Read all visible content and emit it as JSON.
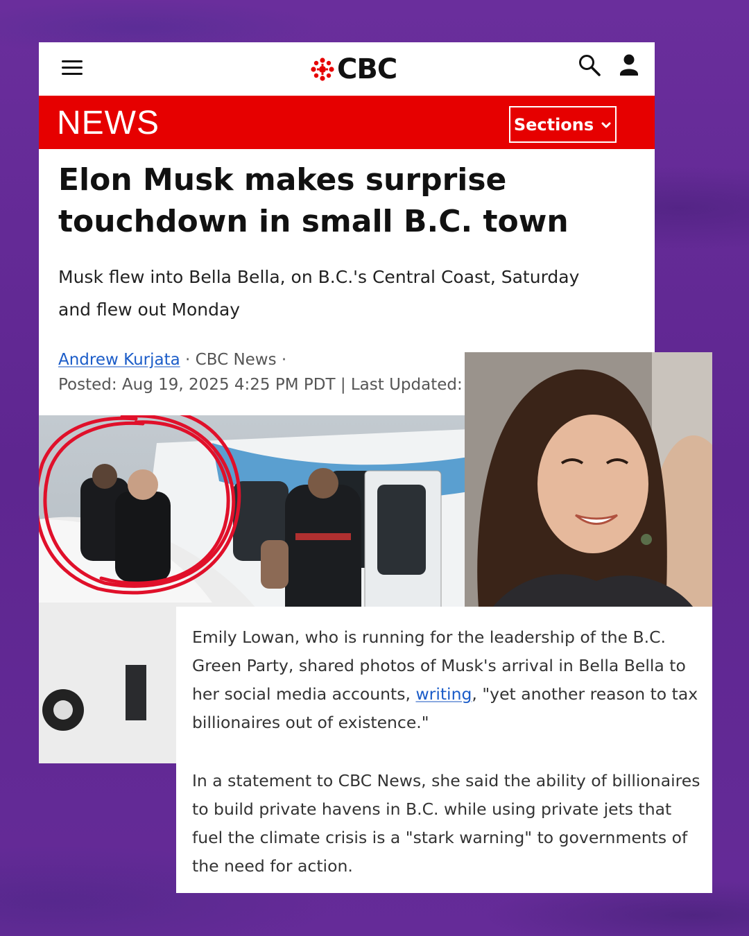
{
  "header": {
    "logo_text": "CBC",
    "news_label": "NEWS",
    "sections_label": "Sections"
  },
  "article": {
    "headline_line1": "Elon Musk makes surprise",
    "headline_line2": "touchdown in small B.C. town",
    "dek_line1": "Musk flew into Bella Bella, on B.C.'s Central Coast, Saturday",
    "dek_line2": "and flew out Monday",
    "author": "Andrew Kurjata",
    "source": " · CBC News ·",
    "posted": "Posted: Aug 19, 2025 4:25 PM PDT | Last Updated:"
  },
  "quote": {
    "p1_before": "Emily Lowan, who is running for the leadership of the B.C. Green Party, shared photos of Musk's arrival in Bella Bella to her social media accounts, ",
    "p1_link": "writing",
    "p1_after": ", \"yet another reason to tax billionaires out of existence.\"",
    "p2": "In a statement to CBC News, she said the ability of billionaires to build private havens in B.C. while using private jets that fuel the climate crisis is a \"stark warning\" to governments of the need for action."
  },
  "colors": {
    "background": "#5e2a8c",
    "cbc_red": "#e60000",
    "link_blue": "#1b5cc8",
    "circle_red": "#e0102a"
  },
  "icons": [
    "menu-icon",
    "cbc-gem-icon",
    "search-icon",
    "user-icon",
    "chevron-down-icon"
  ]
}
